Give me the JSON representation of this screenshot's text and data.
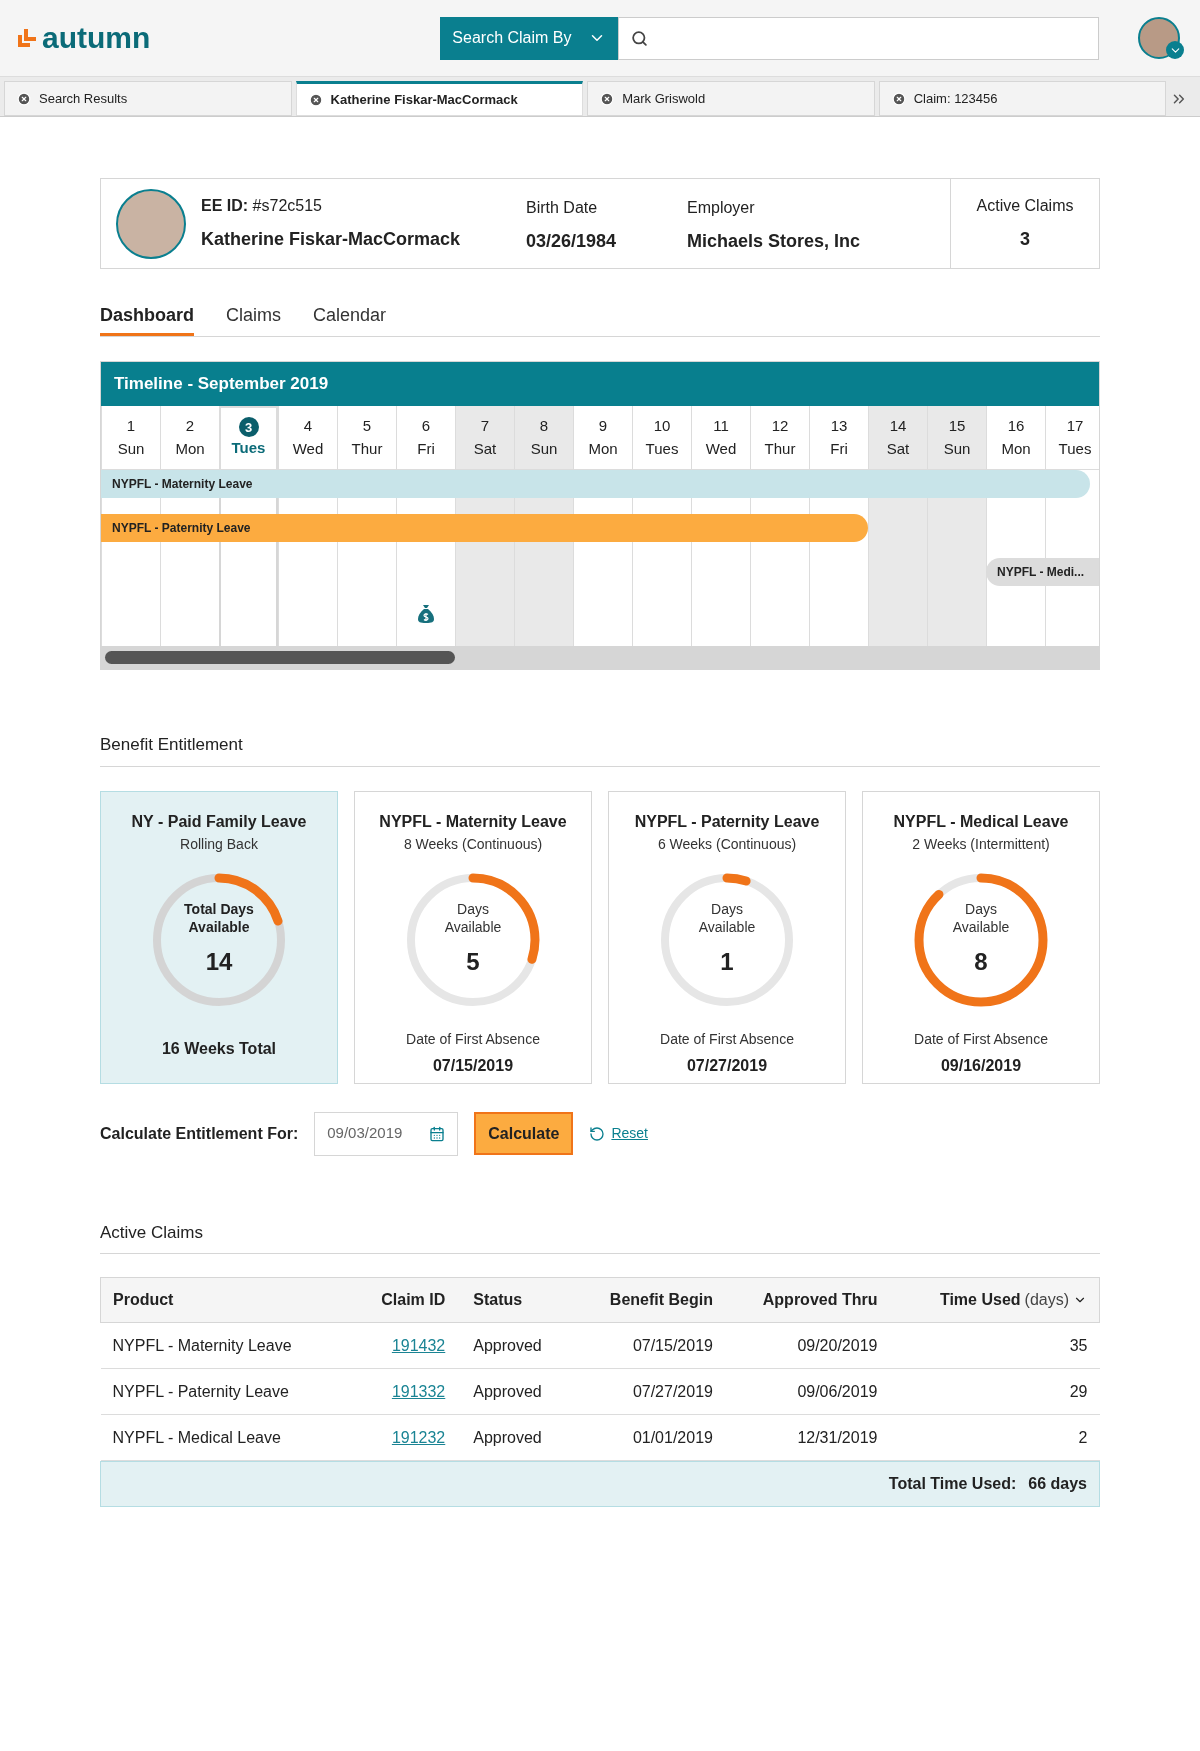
{
  "header": {
    "logo": "autumn",
    "search_button": "Search Claim By"
  },
  "tabs": [
    {
      "label": "Search Results",
      "selected": false
    },
    {
      "label": "Katherine Fiskar-MacCormack",
      "selected": true
    },
    {
      "label": "Mark Griswold",
      "selected": false
    },
    {
      "label": "Claim: 123456",
      "selected": false
    }
  ],
  "profile": {
    "ee_id_label": "EE ID:",
    "ee_id": "#s72c515",
    "name": "Katherine Fiskar-MacCormack",
    "birth_label": "Birth Date",
    "birth_date": "03/26/1984",
    "employer_label": "Employer",
    "employer": "Michaels Stores, Inc",
    "active_label": "Active Claims",
    "active_count": "3"
  },
  "page_tabs": [
    {
      "label": "Dashboard",
      "selected": true
    },
    {
      "label": "Claims",
      "selected": false
    },
    {
      "label": "Calendar",
      "selected": false
    }
  ],
  "timeline": {
    "title": "Timeline - September 2019",
    "days": [
      {
        "num": "1",
        "day": "Sun",
        "weekend": false,
        "selected": false,
        "payment": false
      },
      {
        "num": "2",
        "day": "Mon",
        "weekend": false,
        "selected": false,
        "payment": false
      },
      {
        "num": "3",
        "day": "Tues",
        "weekend": false,
        "selected": true,
        "payment": false
      },
      {
        "num": "4",
        "day": "Wed",
        "weekend": false,
        "selected": false,
        "payment": false
      },
      {
        "num": "5",
        "day": "Thur",
        "weekend": false,
        "selected": false,
        "payment": false
      },
      {
        "num": "6",
        "day": "Fri",
        "weekend": false,
        "selected": false,
        "payment": true
      },
      {
        "num": "7",
        "day": "Sat",
        "weekend": true,
        "selected": false,
        "payment": false
      },
      {
        "num": "8",
        "day": "Sun",
        "weekend": true,
        "selected": false,
        "payment": false
      },
      {
        "num": "9",
        "day": "Mon",
        "weekend": false,
        "selected": false,
        "payment": false
      },
      {
        "num": "10",
        "day": "Tues",
        "weekend": false,
        "selected": false,
        "payment": false
      },
      {
        "num": "11",
        "day": "Wed",
        "weekend": false,
        "selected": false,
        "payment": false
      },
      {
        "num": "12",
        "day": "Thur",
        "weekend": false,
        "selected": false,
        "payment": false
      },
      {
        "num": "13",
        "day": "Fri",
        "weekend": false,
        "selected": false,
        "payment": false
      },
      {
        "num": "14",
        "day": "Sat",
        "weekend": true,
        "selected": false,
        "payment": false
      },
      {
        "num": "15",
        "day": "Sun",
        "weekend": true,
        "selected": false,
        "payment": false
      },
      {
        "num": "16",
        "day": "Mon",
        "weekend": false,
        "selected": false,
        "payment": false
      },
      {
        "num": "17",
        "day": "Tues",
        "weekend": false,
        "selected": false,
        "payment": false
      }
    ],
    "bars": [
      {
        "label": "NYPFL - Maternity Leave",
        "color": "#c8e4e9"
      },
      {
        "label": "NYPFL - Paternity Leave",
        "color": "#fcab40"
      },
      {
        "label": "NYPFL - Medi...",
        "color": "#dcdcdc"
      }
    ]
  },
  "entitlement": {
    "title": "Benefit Entitlement",
    "cards": [
      {
        "kind": "total",
        "selected": true,
        "title": "NY - Paid Family Leave",
        "subtitle": "Rolling Back",
        "gauge_label": "Total Days Available",
        "value": "14",
        "level": 0.2,
        "footer": "16 Weeks Total"
      },
      {
        "kind": "absence",
        "selected": false,
        "title": "NYPFL - Maternity Leave",
        "subtitle": "8 Weeks (Continuous)",
        "gauge_label": "Days Available",
        "value": "5",
        "level": 0.3,
        "footer_label": "Date of First Absence",
        "footer": "07/15/2019"
      },
      {
        "kind": "absence",
        "selected": false,
        "title": "NYPFL - Paternity Leave",
        "subtitle": "6 Weeks (Continuous)",
        "gauge_label": "Days Available",
        "value": "1",
        "level": 0.05,
        "footer_label": "Date of First Absence",
        "footer": "07/27/2019"
      },
      {
        "kind": "absence",
        "selected": false,
        "title": "NYPFL - Medical Leave",
        "subtitle": "2 Weeks (Intermittent)",
        "gauge_label": "Days Available",
        "value": "8",
        "level": 0.88,
        "footer_label": "Date of First Absence",
        "footer": "09/16/2019"
      }
    ],
    "calc_label": "Calculate Entitlement For:",
    "date_value": "09/03/2019",
    "calc_button": "Calculate",
    "reset": "Reset"
  },
  "claims": {
    "title": "Active Claims",
    "columns": [
      {
        "label": "Product",
        "sorted": false
      },
      {
        "label": "Claim ID",
        "sorted": false
      },
      {
        "label": "Status",
        "sorted": false
      },
      {
        "label": "Benefit Begin",
        "sorted": false
      },
      {
        "label": "Approved Thru",
        "sorted": false
      },
      {
        "label": "Time Used",
        "unit": "(days)",
        "sorted": true
      }
    ],
    "rows": [
      [
        "NYPFL - Maternity Leave",
        "191432",
        "Approved",
        "07/15/2019",
        "09/20/2019",
        "35"
      ],
      [
        "NYPFL - Paternity Leave",
        "191332",
        "Approved",
        "07/27/2019",
        "09/06/2019",
        "29"
      ],
      [
        "NYPFL - Medical Leave",
        "191232",
        "Approved",
        "01/01/2019",
        "12/31/2019",
        "2"
      ]
    ],
    "total_label": "Total Time Used:",
    "total_value": "66 days"
  }
}
